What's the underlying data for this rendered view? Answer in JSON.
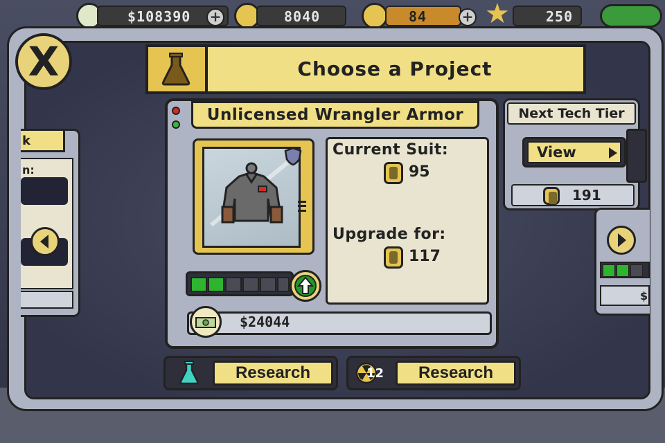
{
  "hud": {
    "money": "$108390",
    "radiation": "8040",
    "energy": "84",
    "stars": "250",
    "plus_label": "+"
  },
  "dialog": {
    "title": "Choose a Project",
    "close_label": "X"
  },
  "left_card": {
    "tab_text": "k",
    "colon_text": "n:"
  },
  "project": {
    "name": "Unlicensed Wrangler Armor",
    "current_suit_label": "Current Suit:",
    "current_suit_value": "95",
    "upgrade_label": "Upgrade for:",
    "upgrade_value": "117",
    "cost": "$24044",
    "level": 2,
    "level_max": 6
  },
  "actions": {
    "research_flask_label": "Research",
    "research_radiation_label": "Research",
    "radiation_cost": "12"
  },
  "next_tier": {
    "heading": "Next Tech Tier",
    "view_label": "View",
    "value": "191"
  },
  "right_card": {
    "cash_text": "$"
  },
  "colors": {
    "panel_yellow": "#f1df86",
    "gold": "#e5c451",
    "level_green": "#2fb42f",
    "upgrade_green": "#1f9a2a",
    "flask_teal": "#3fd3c2",
    "led_red": "#d42a2a",
    "led_green": "#3fb33f"
  }
}
